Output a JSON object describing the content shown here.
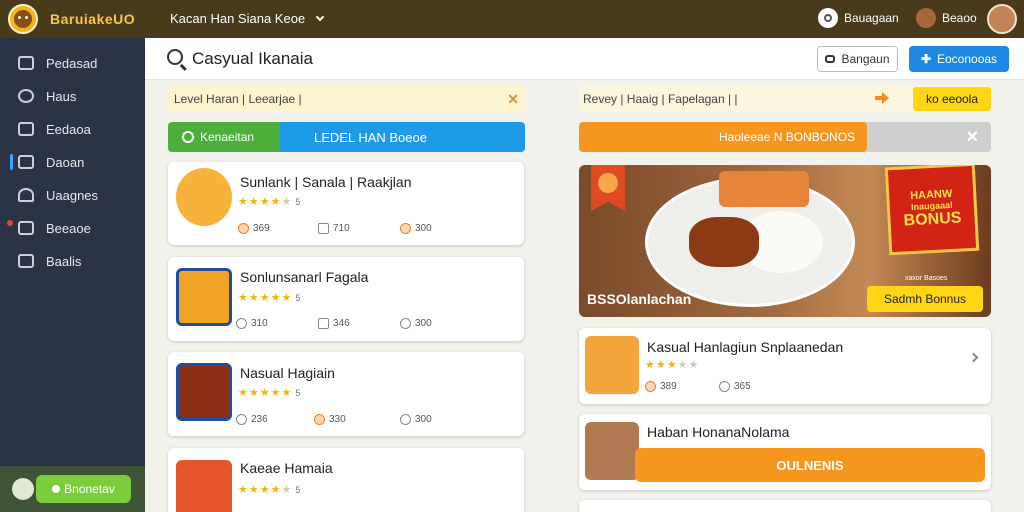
{
  "app": {
    "brand": "BaruiakeUO"
  },
  "topbar": {
    "nav_label": "Kacan Han Siana Keoe",
    "user1_label": "Bauagaan",
    "user2_label": "Beaoo"
  },
  "sidebar": {
    "items": [
      {
        "label": "Pedasad",
        "icon": "home-icon"
      },
      {
        "label": "Haus",
        "icon": "gear-icon"
      },
      {
        "label": "Eedaoa",
        "icon": "calendar-icon"
      },
      {
        "label": "Daoan",
        "icon": "document-icon"
      },
      {
        "label": "Uaagnes",
        "icon": "user-icon"
      },
      {
        "label": "Beeaoe",
        "icon": "grid-icon"
      },
      {
        "label": "Baalis",
        "icon": "box-icon"
      }
    ],
    "bottom_button": "Bnonetav"
  },
  "header": {
    "title": "Casyual Ikanaia",
    "button_secondary": "Bangaun",
    "button_primary": "Eoconooas"
  },
  "left_panel": {
    "filter_text": "Level Haran | Leearjae |",
    "tab_green": "Kenaeitan",
    "tab_blue": "LEDEL HAN Boeoe",
    "cards": [
      {
        "title": "Sunlank | Sanala | Raakjlan",
        "rating": 4,
        "count": "5",
        "meta": [
          "369",
          "710",
          "300"
        ],
        "thumb_color": "#f6b23a"
      },
      {
        "title": "Sonlunsanarl Fagala",
        "rating": 5,
        "count": "5",
        "meta": [
          "310",
          "346",
          "300"
        ],
        "thumb_color": "#f2a524"
      },
      {
        "title": "Nasual Hagiain",
        "rating": 5,
        "count": "5",
        "meta": [
          "236",
          "330",
          "300"
        ],
        "thumb_color": "#8a2d12"
      },
      {
        "title": "Kaeae Hamaia",
        "rating": 4,
        "count": "5",
        "meta": [],
        "thumb_color": "#e9552a"
      }
    ]
  },
  "right_panel": {
    "filter_text": "Revey | Haaig | Fapelagan | |",
    "filter_button": "ko eeoola",
    "progress_label": "Haoleeae N BONBONOS",
    "progress": 0.7,
    "promo": {
      "caption": "BSSOlanlachan",
      "badge_lines": [
        "HAANW",
        "BONUS"
      ],
      "badge_sub": "Inaugaaal",
      "fine_text": "xaxor Basoes",
      "button": "Sadmh Bonnus"
    },
    "cards": [
      {
        "title": "Kasual Hanlagiun Snplaanedan",
        "rating": 3,
        "meta": [
          "389",
          "365"
        ],
        "thumb_color": "#f3a43a"
      },
      {
        "title": "Haban HonanaNolama",
        "button": "OULNENIS",
        "thumb_color": "#b07a52"
      }
    ]
  },
  "colors": {
    "accent_blue": "#1e9be8",
    "accent_green": "#4caf3a",
    "accent_orange": "#f7961e",
    "accent_yellow": "#ffd516"
  }
}
